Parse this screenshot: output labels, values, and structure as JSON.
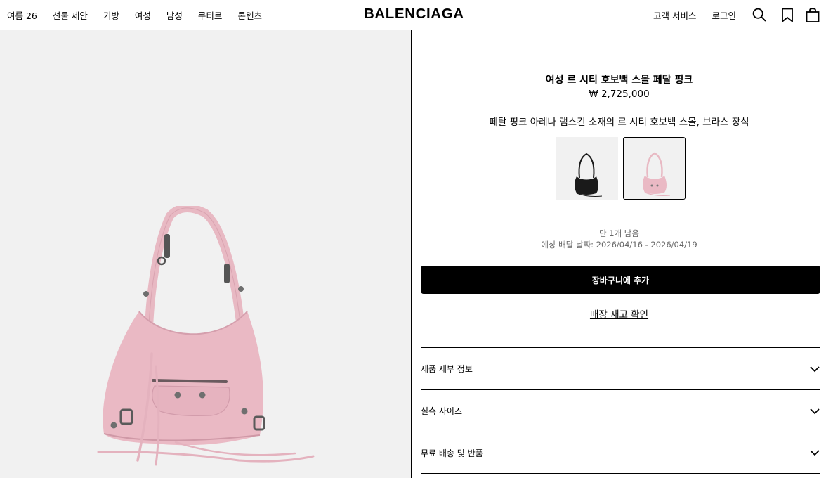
{
  "nav": {
    "left_items": [
      {
        "label": "여름 26"
      },
      {
        "label": "선물 제안"
      },
      {
        "label": "기방"
      },
      {
        "label": "여성"
      },
      {
        "label": "남성"
      },
      {
        "label": "쿠티르"
      },
      {
        "label": "콘텐츠"
      }
    ],
    "logo": "BALENCIAGA",
    "customer_service": "고객 서비스",
    "login": "로그인",
    "icons": [
      "search-icon",
      "bookmark-icon",
      "shopping-bag-icon"
    ]
  },
  "product": {
    "title": "여성 르 시티 호보백 스몰 페탈 핑크",
    "price": "₩ 2,725,000",
    "description": "페탈 핑크 아레나 램스킨 소재의 르 시티 호보백 스몰, 브라스 장식",
    "variants": [
      {
        "color": "black",
        "swatch_hex": "#1a1a1a",
        "selected": false
      },
      {
        "color": "petal pink",
        "swatch_hex": "#eab9c4",
        "selected": true
      }
    ],
    "stock_note": "단 1개 남음",
    "delivery_note": "예상 배달 날짜: 2026/04/16 - 2026/04/19",
    "add_to_cart": "장바구니에 추가",
    "store_stock": "매장 재고 확인"
  },
  "accordion": [
    {
      "label": "제품 세부 정보"
    },
    {
      "label": "실측 사이즈"
    },
    {
      "label": "무료 배송 및 반품"
    }
  ],
  "colors": {
    "image_bg": "#f1f1f1",
    "bag_pink": "#eab9c4",
    "accent": "#000000"
  }
}
